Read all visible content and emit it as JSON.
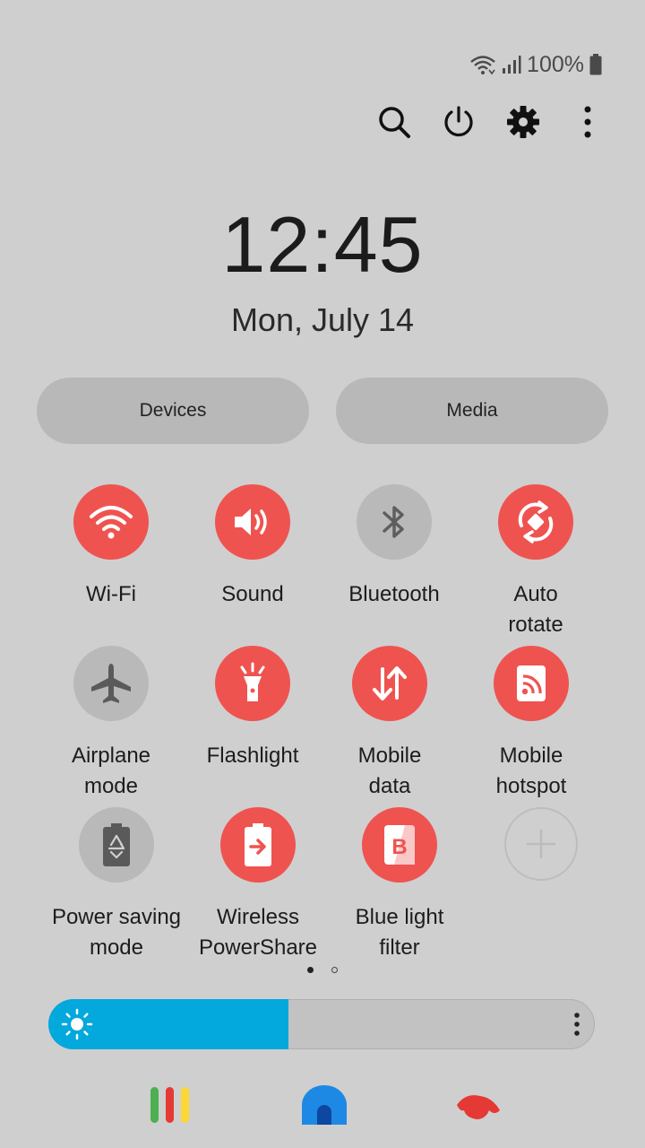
{
  "status": {
    "battery_text": "100%"
  },
  "clock": {
    "time": "12:45",
    "date": "Mon, July 14"
  },
  "pills": {
    "devices": "Devices",
    "media": "Media"
  },
  "tiles": [
    {
      "label": "Wi-Fi",
      "state": "on",
      "icon": "wifi-icon"
    },
    {
      "label": "Sound",
      "state": "on",
      "icon": "sound-icon"
    },
    {
      "label": "Bluetooth",
      "state": "off",
      "icon": "bluetooth-icon"
    },
    {
      "label": "Auto\nrotate",
      "state": "on",
      "icon": "auto-rotate-icon"
    },
    {
      "label": "Airplane\nmode",
      "state": "off",
      "icon": "airplane-icon"
    },
    {
      "label": "Flashlight",
      "state": "on",
      "icon": "flashlight-icon"
    },
    {
      "label": "Mobile\ndata",
      "state": "on",
      "icon": "mobile-data-icon"
    },
    {
      "label": "Mobile\nhotspot",
      "state": "on",
      "icon": "hotspot-icon"
    },
    {
      "label": "Power saving\nmode",
      "state": "off",
      "icon": "power-saving-icon"
    },
    {
      "label": "Wireless\nPowerShare",
      "state": "on",
      "icon": "wireless-powershare-icon"
    },
    {
      "label": "Blue light\nfilter",
      "state": "on",
      "icon": "blue-light-filter-icon"
    },
    {
      "label": "",
      "state": "add",
      "icon": "add-icon"
    }
  ],
  "pager": {
    "pages": 2,
    "current": 1
  },
  "brightness": {
    "level": 0.44
  },
  "colors": {
    "accent_on": "#ef5350",
    "tile_off": "#b9b9b9",
    "brightness_fill": "#03a8dc",
    "background": "#cfcfcf"
  }
}
